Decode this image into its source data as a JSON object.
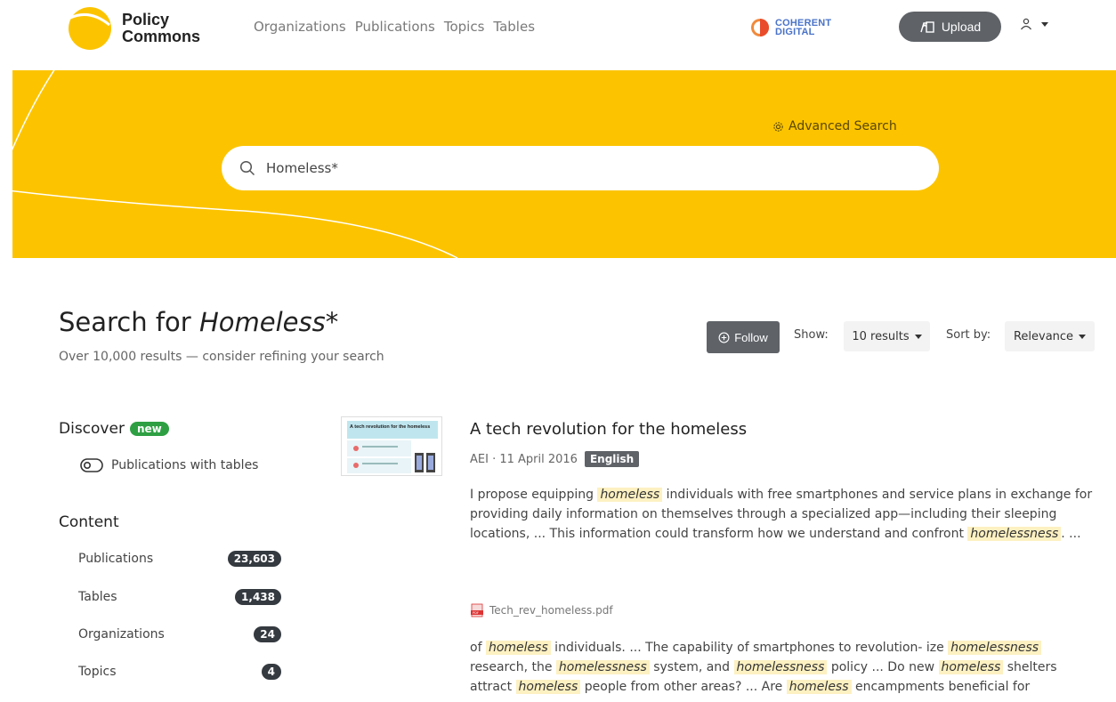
{
  "header": {
    "logo_line1": "Policy",
    "logo_line2": "Commons",
    "nav": [
      "Organizations",
      "Publications",
      "Topics",
      "Tables"
    ],
    "partner_line1": "COHERENT",
    "partner_line2": "DIGITAL",
    "upload_label": "Upload"
  },
  "hero": {
    "advanced_search_label": "Advanced Search",
    "search_value": "Homeless*"
  },
  "results_header": {
    "title_prefix": "Search for ",
    "query": "Homeless*",
    "subtitle": "Over 10,000 results — consider refining your search",
    "follow_label": "Follow",
    "show_label": "Show:",
    "show_value": "10 results",
    "sort_label": "Sort by:",
    "sort_value": "Relevance"
  },
  "sidebar": {
    "discover_title": "Discover",
    "new_badge": "new",
    "toggle_label": "Publications with tables",
    "content_title": "Content",
    "facets": [
      {
        "label": "Publications",
        "count": "23,603"
      },
      {
        "label": "Tables",
        "count": "1,438"
      },
      {
        "label": "Organizations",
        "count": "24"
      },
      {
        "label": "Topics",
        "count": "4"
      }
    ]
  },
  "result": {
    "title": "A tech revolution for the homeless",
    "meta": "AEI · 11 April 2016",
    "language": "English",
    "thumb_title": "A tech revolution for the homeless",
    "snippet1": {
      "a": "I propose equipping ",
      "m1": "homeless",
      "b": " individuals with free smartphones and service plans in exchange for providing daily information on themselves through a specialized app—including their sleeping locations,  ...  This information could transform how we understand and confront ",
      "m2": "homelessness",
      "c": ".  ..."
    },
    "pdf_name": "Tech_rev_homeless.pdf",
    "snippet2": {
      "a": "of ",
      "m1": "homeless",
      "b": " individuals.  ...  The capability of smartphones to revolution- ize ",
      "m2": "homelessness",
      "c": " research, the ",
      "m3": "homelessness",
      "d": " system, and ",
      "m4": "homelessness",
      "e": " policy  ...  Do new ",
      "m5": "homeless",
      "f": " shelters attract ",
      "m6": "homeless",
      "g": " people from other areas?  ...  Are ",
      "m7": "homeless",
      "h": " encampments beneficial for"
    }
  },
  "colors": {
    "brand_yellow": "#fcc400",
    "button_gray": "#5f6368",
    "badge_dark": "#343a40",
    "new_green": "#2ea043",
    "highlight": "#fdf1c2"
  }
}
